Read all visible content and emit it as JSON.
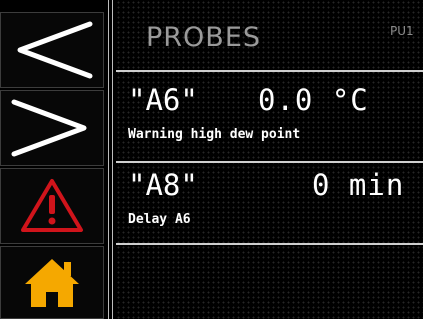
{
  "sidebar": {
    "buttons": [
      {
        "id": "back",
        "icon": "chevron-left-icon",
        "color": "#ffffff"
      },
      {
        "id": "forward",
        "icon": "chevron-right-icon",
        "color": "#ffffff"
      },
      {
        "id": "alarm",
        "icon": "warning-icon",
        "color": "#d0141b"
      },
      {
        "id": "home",
        "icon": "home-icon",
        "color": "#f5a800"
      }
    ]
  },
  "header": {
    "title": "PROBES",
    "unit_tag": "PU1"
  },
  "rows": [
    {
      "code": "\"A6\"",
      "value": "0.0 °C",
      "message": "Warning high dew point"
    },
    {
      "code": "\"A8\"",
      "value": "0 min",
      "message": "Delay A6"
    }
  ]
}
